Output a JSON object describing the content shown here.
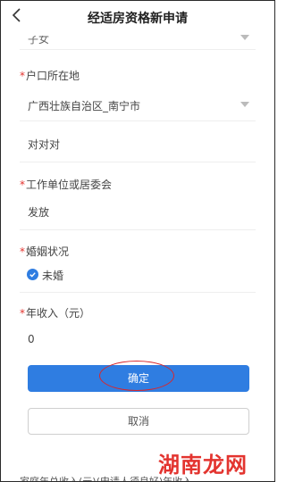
{
  "header": {
    "back_icon": "chevron-left-icon",
    "title": "经适房资格新申请"
  },
  "form": {
    "top_partial_value": "子女",
    "hukou": {
      "required_mark": "*",
      "label": "户口所在地",
      "value": "广西壮族自治区_南宁市",
      "detail": "对对对"
    },
    "employer": {
      "required_mark": "*",
      "label": "工作单位或居委会",
      "value": "发放"
    },
    "marital": {
      "required_mark": "*",
      "label": "婚姻状况",
      "option": "未婚",
      "selected": true
    },
    "income": {
      "required_mark": "*",
      "label": "年收入（元）",
      "value": "0"
    }
  },
  "actions": {
    "confirm_label": "确定",
    "cancel_label": "取消"
  },
  "footer": {
    "partial_text": "家庭年总收入(元)(申请人须良好)年收入"
  },
  "watermark": {
    "text": "湖南龙网"
  },
  "colors": {
    "accent": "#2f7de1",
    "required": "#e3342f",
    "annotation": "#d9262b"
  }
}
